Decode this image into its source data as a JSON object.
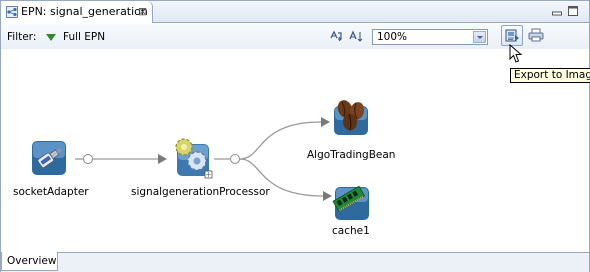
{
  "editor_tab": {
    "title": "EPN: signal_generation",
    "close_glyph": "⊠",
    "icon": "epn-icon"
  },
  "window_controls": {
    "minimize_icon": "minimize-icon",
    "maximize_icon": "maximize-icon"
  },
  "toolbar": {
    "filter_label": "Filter:",
    "filter_value": "Full EPN",
    "layout_icon": "auto-layout-icon",
    "sort_icon": "sort-icon",
    "zoom_value": "100%",
    "export_icon": "export-image-icon",
    "print_icon": "print-icon"
  },
  "tooltip": {
    "text": "Export to Image"
  },
  "nodes": [
    {
      "id": "socketAdapter",
      "label": "socketAdapter",
      "icon": "adapter-plug-icon"
    },
    {
      "id": "signalgenerationProcessor",
      "label": "signalgenerationProcessor",
      "icon": "processor-gears-icon"
    },
    {
      "id": "AlgoTradingBean",
      "label": "AlgoTradingBean",
      "icon": "bean-coffee-icon"
    },
    {
      "id": "cache1",
      "label": "cache1",
      "icon": "cache-memory-icon"
    }
  ],
  "bottom_tabs": {
    "overview_label": "Overview"
  },
  "colors": {
    "accent": "#98a8bf",
    "connector": "#9a9a9a",
    "filter_triangle": "#2e8b2e",
    "tooltip_bg": "#ffffe1"
  }
}
